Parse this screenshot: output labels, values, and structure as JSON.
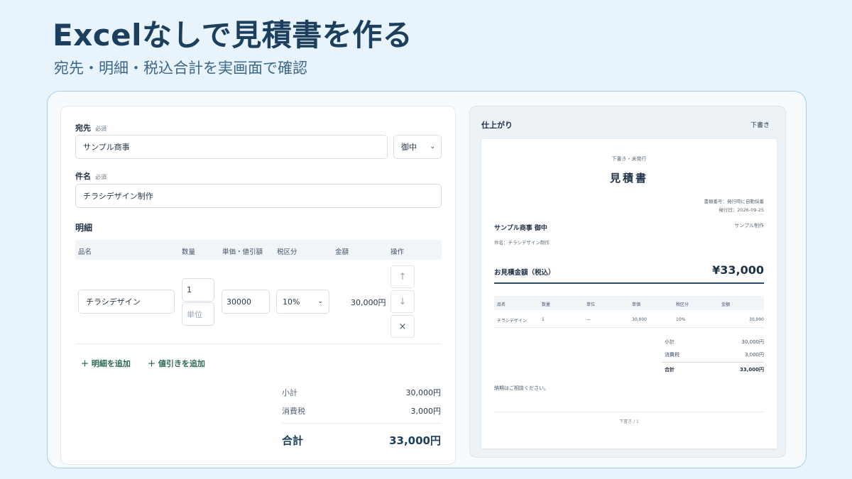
{
  "hero": {
    "title": "Excelなしで見積書を作る",
    "subtitle": "宛先・明細・税込合計を実画面で確認"
  },
  "editor": {
    "recipient": {
      "label": "宛先",
      "required": "必須",
      "value": "サンプル商事",
      "honorific": "御中"
    },
    "subject": {
      "label": "件名",
      "required": "必須",
      "value": "チラシデザイン制作"
    },
    "details_title": "明細",
    "columns": [
      "品名",
      "数量",
      "単価・値引額",
      "税区分",
      "金額",
      "操作"
    ],
    "line": {
      "item": "チラシデザイン",
      "qty": "1",
      "unit_placeholder": "単位",
      "price": "30000",
      "tax": "10%",
      "amount": "30,000円"
    },
    "actions": {
      "up": "↑",
      "down": "↓",
      "delete": "×"
    },
    "add_line": "＋ 明細を追加",
    "add_discount": "＋ 値引きを追加",
    "summary": {
      "subtotal_label": "小計",
      "subtotal": "30,000円",
      "tax_label": "消費税",
      "tax": "3,000円",
      "total_label": "合計",
      "total": "33,000円"
    }
  },
  "preview": {
    "title": "仕上がり",
    "status": "下書き",
    "doc": {
      "draft_note": "下書き・未発行",
      "title": "見積書",
      "doc_number": "書類番号：発行時に自動採番",
      "issue_date": "発行日：2026-09-25",
      "client": "サンプル商事 御中",
      "issuer": "サンプル制作",
      "subject": "件名：チラシデザイン制作",
      "quote_label": "お見積金額（税込）",
      "quote_value": "¥33,000",
      "columns": [
        "品名",
        "数量",
        "単位",
        "単価",
        "税区分",
        "金額"
      ],
      "row": [
        "チラシデザイン",
        "1",
        "—",
        "30,000",
        "10%",
        "30,000"
      ],
      "subtotal_label": "小計",
      "subtotal": "30,000円",
      "tax_label": "消費税",
      "tax": "3,000円",
      "total_label": "合計",
      "total": "33,000円",
      "note": "納期はご相談ください。",
      "footer": "下書き / 1"
    }
  }
}
